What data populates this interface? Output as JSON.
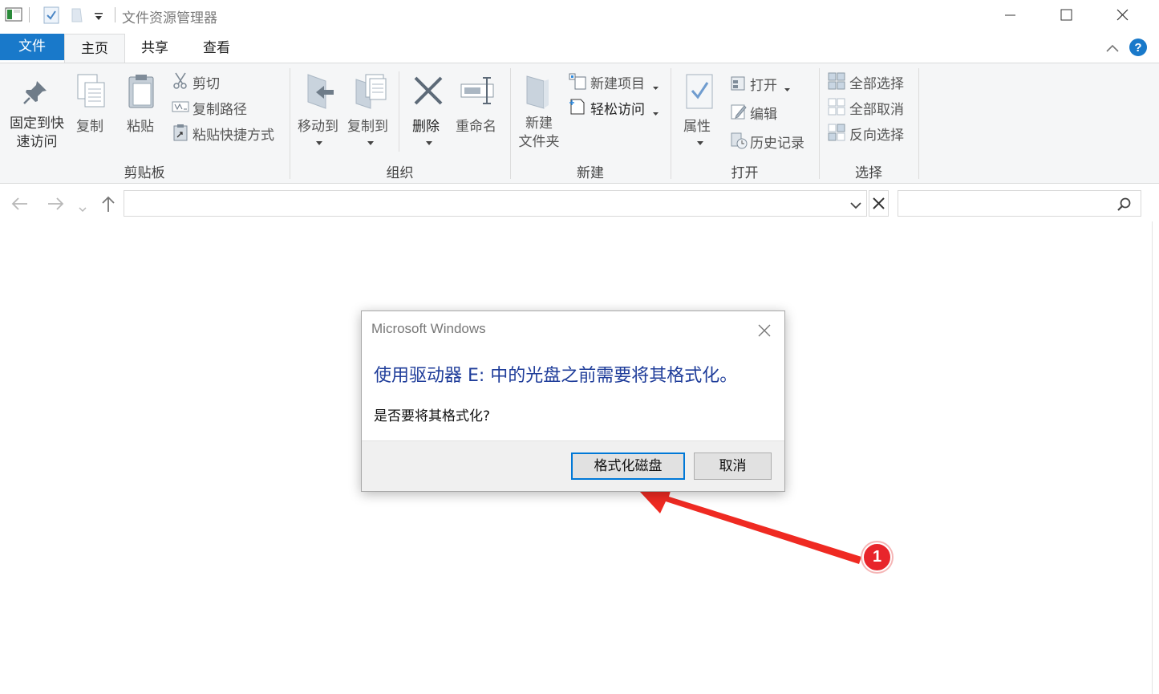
{
  "window": {
    "title": "文件资源管理器"
  },
  "tabs": [
    "文件",
    "主页",
    "共享",
    "查看"
  ],
  "ribbon": {
    "clipboard": {
      "pin": "固定到快\n速访问",
      "copy": "复制",
      "paste": "粘贴",
      "cut": "剪切",
      "copy_path": "复制路径",
      "paste_shortcut": "粘贴快捷方式",
      "label": "剪贴板"
    },
    "organize": {
      "move_to": "移动到",
      "copy_to": "复制到",
      "delete": "删除",
      "rename": "重命名",
      "label": "组织"
    },
    "new": {
      "new_folder": "新建\n文件夹",
      "new_item": "新建项目",
      "easy_access": "轻松访问",
      "label": "新建"
    },
    "open": {
      "properties": "属性",
      "open": "打开",
      "edit": "编辑",
      "history": "历史记录",
      "label": "打开"
    },
    "select": {
      "select_all": "全部选择",
      "select_none": "全部取消",
      "invert": "反向选择",
      "label": "选择"
    }
  },
  "address": {
    "value": "",
    "search_placeholder": ""
  },
  "dialog": {
    "title": "Microsoft Windows",
    "message": "使用驱动器 E: 中的光盘之前需要将其格式化。",
    "question": "是否要将其格式化?",
    "format_button": "格式化磁盘",
    "cancel_button": "取消"
  },
  "annotation": {
    "badge": "1"
  },
  "colors": {
    "accent": "#1979ca",
    "dialog_heading": "#1f3d9a",
    "annotation": "#e8252b",
    "primary_border": "#0078d7"
  }
}
